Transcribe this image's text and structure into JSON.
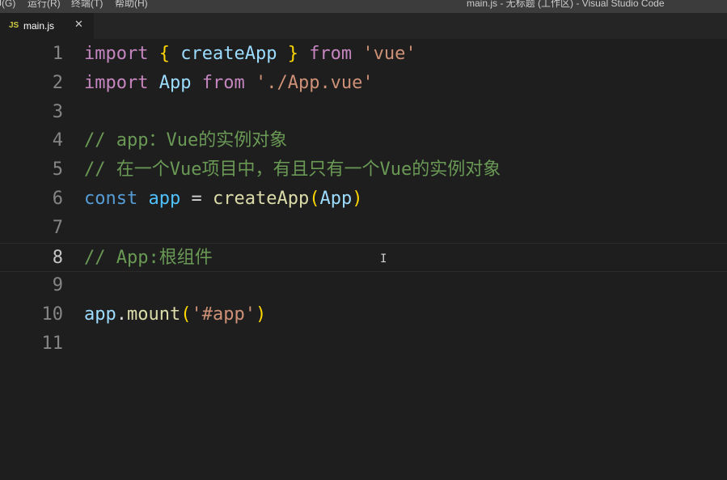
{
  "window": {
    "title": "main.js - 无标题 (工作区) - Visual Studio Code"
  },
  "menu": {
    "items": [
      {
        "label": "J(G)"
      },
      {
        "label": "运行(R)"
      },
      {
        "label": "终端(T)"
      },
      {
        "label": "帮助(H)"
      }
    ]
  },
  "tab": {
    "icon": "JS",
    "label": "main.js",
    "close": "✕"
  },
  "code": {
    "line_numbers": [
      "1",
      "2",
      "3",
      "4",
      "5",
      "6",
      "7",
      "8",
      "9",
      "10",
      "11"
    ],
    "active_line": "8",
    "lines": [
      [
        {
          "t": "import",
          "c": "keyword"
        },
        {
          "t": " ",
          "c": "plain"
        },
        {
          "t": "{",
          "c": "brace"
        },
        {
          "t": " createApp ",
          "c": "var"
        },
        {
          "t": "}",
          "c": "brace"
        },
        {
          "t": " ",
          "c": "plain"
        },
        {
          "t": "from",
          "c": "keyword"
        },
        {
          "t": " ",
          "c": "plain"
        },
        {
          "t": "'vue'",
          "c": "string"
        }
      ],
      [
        {
          "t": "import",
          "c": "keyword"
        },
        {
          "t": " ",
          "c": "plain"
        },
        {
          "t": "App",
          "c": "var"
        },
        {
          "t": " ",
          "c": "plain"
        },
        {
          "t": "from",
          "c": "keyword"
        },
        {
          "t": " ",
          "c": "plain"
        },
        {
          "t": "'./App.vue'",
          "c": "string"
        }
      ],
      [],
      [
        {
          "t": "// app：Vue的实例对象",
          "c": "comment"
        }
      ],
      [
        {
          "t": "// 在一个Vue项目中，有且只有一个Vue的实例对象",
          "c": "comment"
        }
      ],
      [
        {
          "t": "const",
          "c": "const"
        },
        {
          "t": " ",
          "c": "plain"
        },
        {
          "t": "app",
          "c": "ident"
        },
        {
          "t": " = ",
          "c": "plain"
        },
        {
          "t": "createApp",
          "c": "func"
        },
        {
          "t": "(",
          "c": "brace"
        },
        {
          "t": "App",
          "c": "var"
        },
        {
          "t": ")",
          "c": "brace"
        }
      ],
      [],
      [
        {
          "t": "// App:根组件",
          "c": "comment"
        }
      ],
      [],
      [
        {
          "t": "app",
          "c": "var"
        },
        {
          "t": ".",
          "c": "plain"
        },
        {
          "t": "mount",
          "c": "func"
        },
        {
          "t": "(",
          "c": "brace"
        },
        {
          "t": "'#app'",
          "c": "string"
        },
        {
          "t": ")",
          "c": "brace"
        }
      ],
      []
    ]
  },
  "cursor": {
    "icon": "text-cursor-icon",
    "glyph": "I"
  }
}
